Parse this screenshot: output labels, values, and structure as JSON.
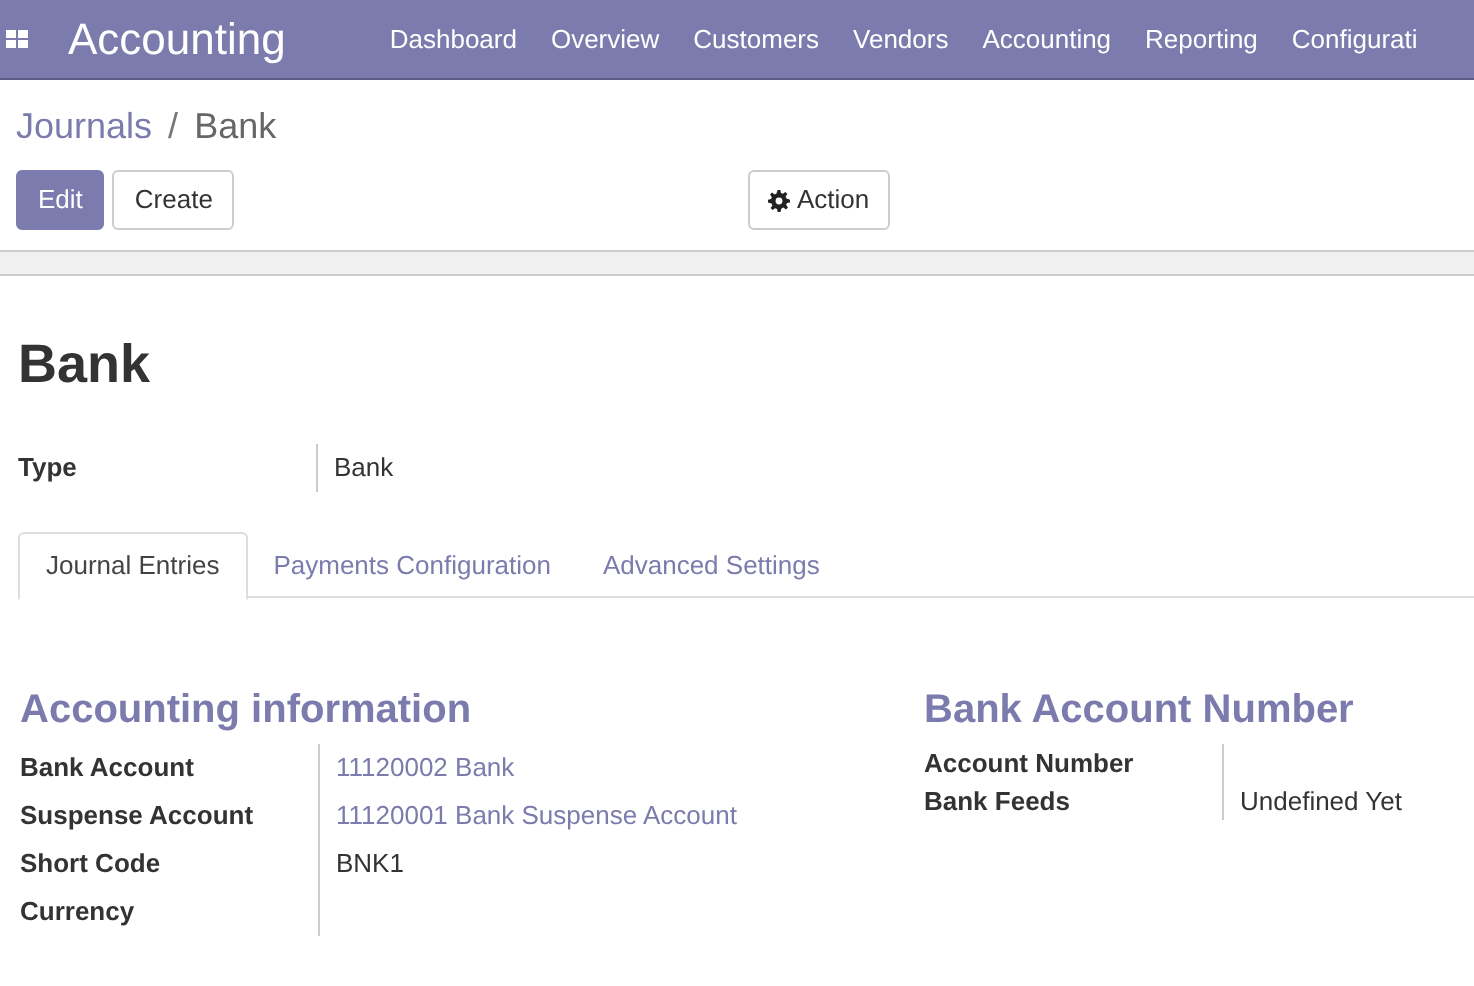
{
  "navbar": {
    "app_title": "Accounting",
    "menu": [
      "Dashboard",
      "Overview",
      "Customers",
      "Vendors",
      "Accounting",
      "Reporting",
      "Configurati"
    ]
  },
  "breadcrumb": [
    {
      "label": "Journals",
      "kind": "link"
    },
    {
      "label": "/",
      "kind": "separator"
    },
    {
      "label": "Bank",
      "kind": "current"
    }
  ],
  "buttons": [
    {
      "label": "Edit",
      "kind": "primary"
    },
    {
      "label": "Create",
      "kind": "secondary"
    }
  ],
  "action_button": {
    "label": "Action"
  },
  "record": {
    "title": "Bank",
    "fields": [
      {
        "label": "Type",
        "value": "Bank"
      }
    ]
  },
  "tabs": [
    {
      "label": "Journal Entries",
      "selected": true
    },
    {
      "label": "Payments Configuration",
      "selected": false
    },
    {
      "label": "Advanced Settings",
      "selected": false
    }
  ],
  "groups": [
    {
      "title": "Accounting information",
      "fields": [
        {
          "label": "Bank Account",
          "value": "11120002 Bank",
          "kind": "link"
        },
        {
          "label": "Suspense Account",
          "value": "11120001 Bank Suspense Account",
          "kind": "link"
        },
        {
          "label": "Short Code",
          "value": "BNK1",
          "kind": "text"
        },
        {
          "label": "Currency"
        }
      ]
    },
    {
      "title": "Bank Account Number",
      "fields": [
        {
          "label": "Account Number"
        },
        {
          "label": "Bank Feeds",
          "value": "Undefined Yet",
          "kind": "text"
        }
      ]
    }
  ]
}
